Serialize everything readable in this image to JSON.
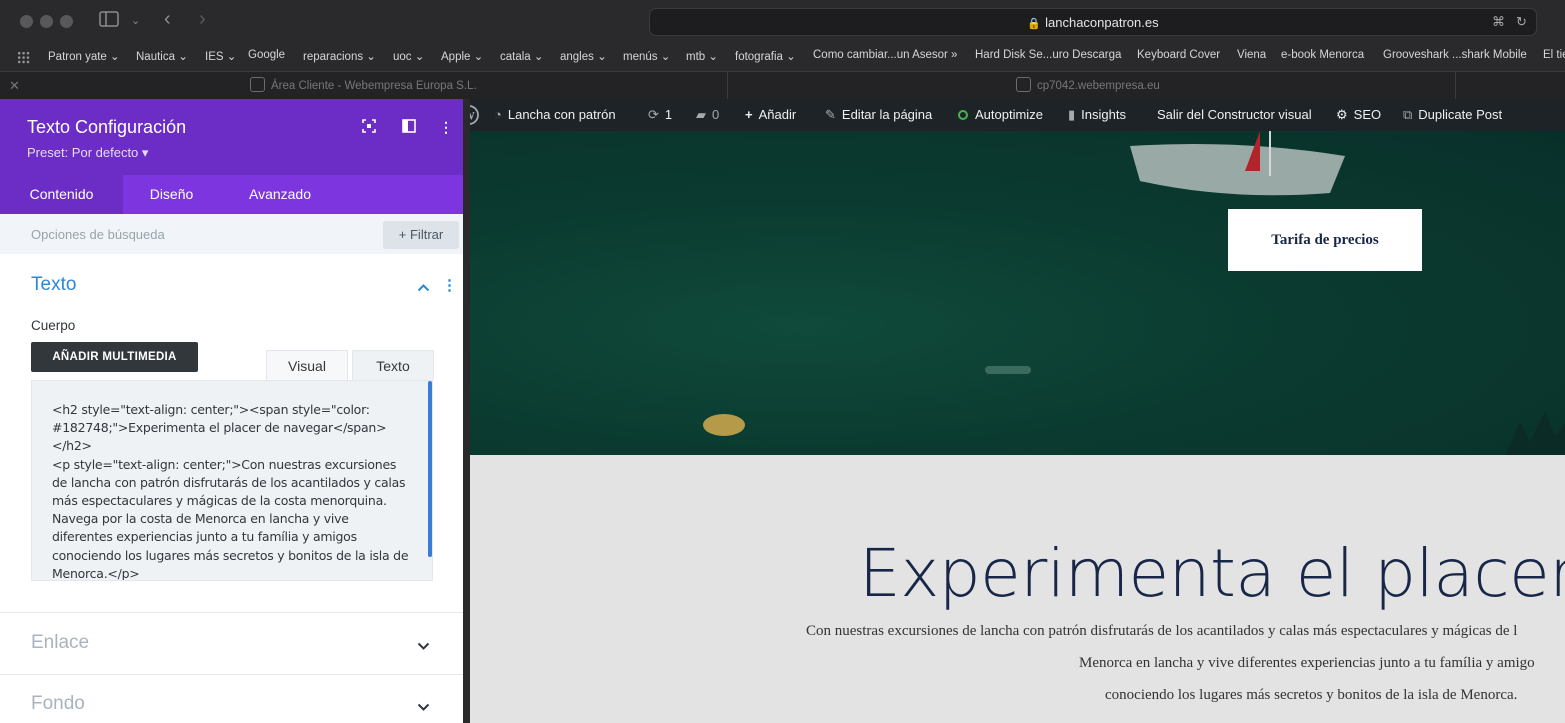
{
  "browser": {
    "url": "lanchaconpatron.es",
    "bookmarks": [
      {
        "label": "Patron yate",
        "menu": true
      },
      {
        "label": "Nautica",
        "menu": true
      },
      {
        "label": "IES",
        "menu": true
      },
      {
        "label": "Google",
        "menu": false
      },
      {
        "label": "reparacions",
        "menu": true
      },
      {
        "label": "uoc",
        "menu": true
      },
      {
        "label": "Apple",
        "menu": true
      },
      {
        "label": "catala",
        "menu": true
      },
      {
        "label": "angles",
        "menu": true
      },
      {
        "label": "menús",
        "menu": true
      },
      {
        "label": "mtb",
        "menu": true
      },
      {
        "label": "fotografia",
        "menu": true
      },
      {
        "label": "Como cambiar...un Asesor »",
        "menu": false
      },
      {
        "label": "Hard Disk Se...uro Descarga",
        "menu": false
      },
      {
        "label": "Keyboard Cover",
        "menu": false
      },
      {
        "label": "Viena",
        "menu": false
      },
      {
        "label": "e-book Menorca",
        "menu": false
      },
      {
        "label": "Grooveshark ...shark Mobile",
        "menu": false
      },
      {
        "label": "El tie",
        "menu": false
      }
    ],
    "tabs": [
      {
        "label": "Área Cliente - Webempresa Europa S.L."
      },
      {
        "label": "cp7042.webempresa.eu"
      }
    ]
  },
  "panel": {
    "title": "Texto Configuración",
    "preset": "Preset: Por defecto ▾",
    "tabs": [
      "Contenido",
      "Diseño",
      "Avanzado"
    ],
    "search_placeholder": "Opciones de búsqueda",
    "filter_label": "+ Filtrar",
    "section_texto": "Texto",
    "cuerpo_label": "Cuerpo",
    "add_media": "AÑADIR MULTIMEDIA",
    "editor_tabs": [
      "Visual",
      "Texto"
    ],
    "code": "<h2 style=\"text-align: center;\"><span style=\"color: #182748;\">Experimenta el placer de navegar</span>\n</h2>\n<p style=\"text-align: center;\">Con nuestras excursiones de lancha con patrón disfrutarás de los acantilados y calas más espectaculares y mágicas de la costa menorquina. Navega por la costa de Menorca en lancha y vive diferentes experiencias junto a tu família y amigos conociendo los lugares más secretos y bonitos de la isla de Menorca.</p>",
    "section_enlace": "Enlace",
    "section_fondo": "Fondo"
  },
  "adminbar": {
    "site": "Lancha con patrón",
    "updates": "1",
    "comments": "0",
    "add": "Añadir",
    "edit": "Editar la página",
    "autoptimize": "Autoptimize",
    "insights": "Insights",
    "exit": "Salir del Constructor visual",
    "seo": "SEO",
    "duplicate": "Duplicate Post"
  },
  "page": {
    "button": "Tarifa de precios",
    "heading": "Experimenta el placer de",
    "para_lines": [
      "Con nuestras excursiones de lancha con patrón disfrutarás de los acantilados y calas más espectaculares y mágicas de l",
      "Menorca en lancha y vive diferentes experiencias junto a tu família y amigo",
      "conociendo los lugares más secretos y bonitos de la isla de Menorca."
    ]
  },
  "colors": {
    "builder_purple": "#6c2dc7",
    "builder_tab": "#7d35e0",
    "link_blue": "#2b87da",
    "heading_navy": "#182748"
  }
}
